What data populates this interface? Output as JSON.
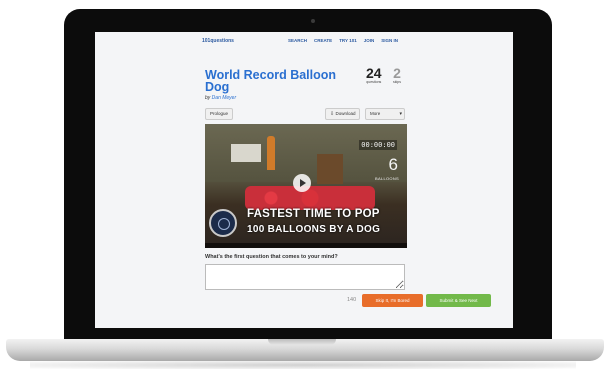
{
  "site": {
    "logo": "101questions"
  },
  "nav": {
    "links": [
      "SEARCH",
      "CREATE",
      "TRY 101",
      "JOIN",
      "SIGN IN"
    ]
  },
  "question": {
    "title": "World Record Balloon Dog",
    "author_prefix": "by",
    "author": "Dan Meyer",
    "questions_count": "24",
    "questions_label": "questions",
    "votes_count": "2",
    "votes_label": "skips"
  },
  "toolbar": {
    "prologue": "Prologue",
    "download": "Download",
    "more": "More"
  },
  "video": {
    "timer": "00:00:00",
    "balloon_count": "6",
    "balloon_label": "BALLOONS",
    "caption_line1": "FASTEST TIME TO POP",
    "caption_line2": "100 BALLOONS BY A DOG"
  },
  "prompt": {
    "text": "What's the first question that comes to your mind?",
    "answer_value": "",
    "char_count": "140",
    "skip_label": "Skip It, I'm Bored",
    "submit_label": "Submit & See Next"
  },
  "colors": {
    "accent": "#2a6fd0",
    "skip": "#e86d2a",
    "submit": "#72b94a"
  }
}
